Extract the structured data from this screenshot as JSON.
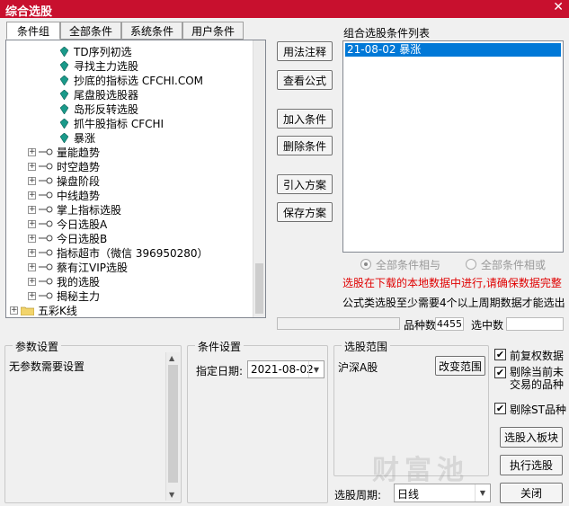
{
  "window": {
    "title": "综合选股",
    "close_glyph": "✕"
  },
  "tabs": [
    "条件组",
    "全部条件",
    "系统条件",
    "用户条件"
  ],
  "tree": {
    "leaves": [
      "TD序列初选",
      "寻找主力选股",
      "抄底的指标选 CFCHI.COM",
      "尾盘股选股器",
      "岛形反转选股",
      "抓牛股指标 CFCHI",
      "暴涨"
    ],
    "groups": [
      "量能趋势",
      "时空趋势",
      "操盘阶段",
      "中线趋势",
      "掌上指标选股",
      "今日选股A",
      "今日选股B",
      "指标超市（微信 396950280）",
      "蔡有江VIP选股",
      "我的选股",
      "揭秘主力"
    ],
    "root": "五彩K线"
  },
  "mid_buttons": [
    "用法注释",
    "查看公式",
    "加入条件",
    "删除条件",
    "引入方案",
    "保存方案"
  ],
  "condition_list": {
    "label": "组合选股条件列表",
    "items": [
      "21-08-02 暴涨"
    ]
  },
  "logic": {
    "and_label": "全部条件相与",
    "or_label": "全部条件相或"
  },
  "warning": "选股在下载的本地数据中进行,请确保数据完整",
  "note": "公式类选股至少需要4个以上周期数据才能选出",
  "counts": {
    "variety_label": "品种数",
    "variety_value": "4455",
    "selected_label": "选中数",
    "selected_value": ""
  },
  "params": {
    "legend": "参数设置",
    "text": "无参数需要设置"
  },
  "cond_settings": {
    "legend": "条件设置",
    "date_label": "指定日期:",
    "date_value": "2021-08-02"
  },
  "range": {
    "legend": "选股范围",
    "value": "沪深A股",
    "change_button": "改变范围"
  },
  "period": {
    "label": "选股周期:",
    "value": "日线"
  },
  "options": [
    {
      "label": "前复权数据",
      "checked": true
    },
    {
      "label": "剔除当前未交易的品种",
      "checked": true
    },
    {
      "label": "剔除ST品种",
      "checked": true
    }
  ],
  "action_buttons": {
    "to_block": "选股入板块",
    "execute": "执行选股",
    "close": "关闭"
  },
  "watermark": "财富池"
}
